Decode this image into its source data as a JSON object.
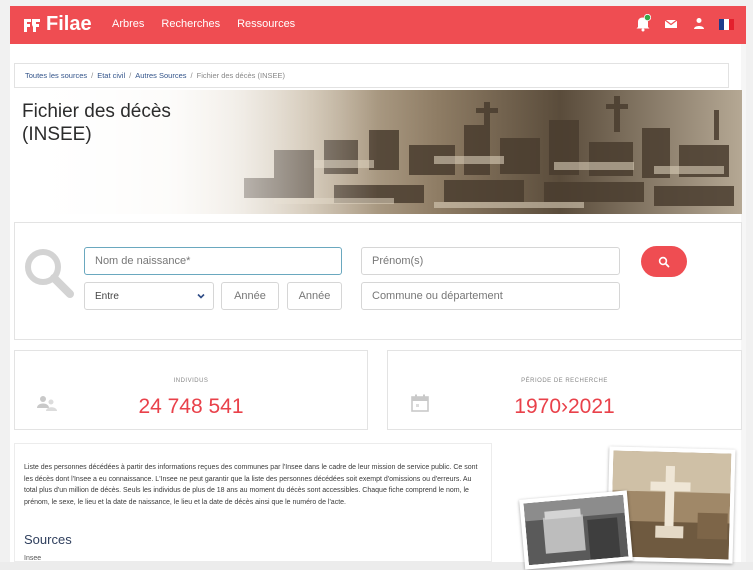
{
  "header": {
    "logo_text": "Filae",
    "nav": [
      "Arbres",
      "Recherches",
      "Ressources"
    ],
    "icons": [
      "notifications-icon",
      "mail-icon",
      "user-icon",
      "flag-fr-icon"
    ],
    "brand_color": "#ef4d52"
  },
  "breadcrumb": {
    "items": [
      "Toutes les sources",
      "Etat civil",
      "Autres Sources",
      "Fichier des décès (INSEE)"
    ],
    "separator": "/"
  },
  "hero": {
    "title": "Fichier des décès (INSEE)"
  },
  "search": {
    "last_name_placeholder": "Nom de naissance*",
    "first_name_placeholder": "Prénom(s)",
    "range_select": "Entre",
    "year_from_placeholder": "Année",
    "year_to_placeholder": "Année",
    "place_placeholder": "Commune ou département"
  },
  "stats": {
    "individuals_label": "INDIVIDUS",
    "individuals_value": "24 748 541",
    "period_label": "PÉRIODE DE RECHERCHE",
    "period_value": "1970›2021"
  },
  "description": {
    "text": "Liste des personnes décédées à partir des informations reçues des communes par l'Insee dans le cadre de leur mission de service public. Ce sont les décès dont l'Insee a eu connaissance. L'Insee ne peut garantir que la liste des personnes décédées soit exempt d'omissions ou d'erreurs. Au total plus d'un million de décès. Seuls les individus de plus de 18 ans au moment du décès sont accessibles. Chaque fiche comprend le nom, le prénom, le sexe, le lieu et la date de naissance, le lieu et la date de décès ainsi que le numéro de l'acte.",
    "sources_title": "Sources",
    "sources_item": "Insee"
  }
}
